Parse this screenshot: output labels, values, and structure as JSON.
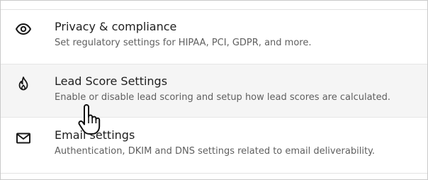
{
  "settings": {
    "items": [
      {
        "title": "Privacy & compliance",
        "description": "Set regulatory settings for HIPAA, PCI, GDPR, and more.",
        "icon": "eye-icon"
      },
      {
        "title": "Lead Score Settings",
        "description": "Enable or disable lead scoring and setup how lead scores are calculated.",
        "icon": "flame-icon",
        "state": "hovered"
      },
      {
        "title": "Email settings",
        "description": "Authentication, DKIM and DNS settings related to email deliverability.",
        "icon": "envelope-icon"
      }
    ]
  },
  "cursor": {
    "type": "pointer-hand"
  },
  "colors": {
    "title": "#1f1f1f",
    "description": "#5f5f5f",
    "hover_background": "#f5f5f5",
    "divider": "#e3e3e3"
  }
}
